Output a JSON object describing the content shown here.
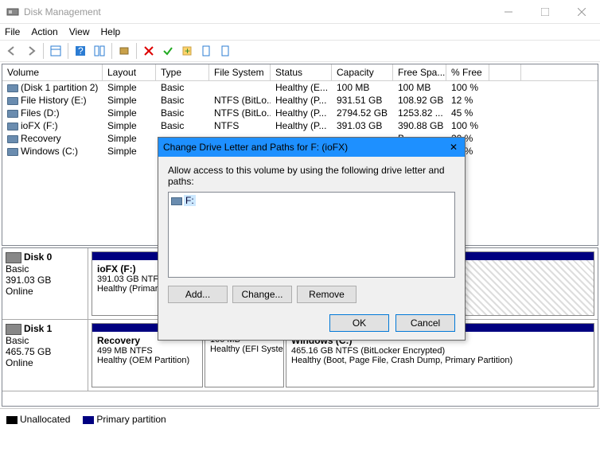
{
  "window": {
    "title": "Disk Management"
  },
  "menu": {
    "file": "File",
    "action": "Action",
    "view": "View",
    "help": "Help"
  },
  "columns": [
    "Volume",
    "Layout",
    "Type",
    "File System",
    "Status",
    "Capacity",
    "Free Spa...",
    "% Free"
  ],
  "volumes": [
    {
      "name": "(Disk 1 partition 2)",
      "layout": "Simple",
      "type": "Basic",
      "fs": "",
      "status": "Healthy (E...",
      "cap": "100 MB",
      "free": "100 MB",
      "pct": "100 %"
    },
    {
      "name": "File History (E:)",
      "layout": "Simple",
      "type": "Basic",
      "fs": "NTFS (BitLo...",
      "status": "Healthy (P...",
      "cap": "931.51 GB",
      "free": "108.92 GB",
      "pct": "12 %"
    },
    {
      "name": "Files (D:)",
      "layout": "Simple",
      "type": "Basic",
      "fs": "NTFS (BitLo...",
      "status": "Healthy (P...",
      "cap": "2794.52 GB",
      "free": "1253.82 ...",
      "pct": "45 %"
    },
    {
      "name": "ioFX (F:)",
      "layout": "Simple",
      "type": "Basic",
      "fs": "NTFS",
      "status": "Healthy (P...",
      "cap": "391.03 GB",
      "free": "390.88 GB",
      "pct": "100 %"
    },
    {
      "name": "Recovery",
      "layout": "Simple",
      "type": "",
      "fs": "",
      "status": "",
      "cap": "",
      "free": "B",
      "pct": "20 %"
    },
    {
      "name": "Windows (C:)",
      "layout": "Simple",
      "type": "",
      "fs": "",
      "status": "",
      "cap": "",
      "free": "7 GB",
      "pct": "12 %"
    }
  ],
  "disks": [
    {
      "name": "Disk 0",
      "type": "Basic",
      "size": "391.03 GB",
      "status": "Online",
      "parts": [
        {
          "name": "ioFX  (F:)",
          "l2": "391.03 GB NTFS",
          "l3": "Healthy (Primary Partition)",
          "flex": "0 0 96px",
          "hatch": false
        },
        {
          "name": "",
          "l2": "",
          "l3": "",
          "flex": "1",
          "hatch": true
        }
      ]
    },
    {
      "name": "Disk 1",
      "type": "Basic",
      "size": "465.75 GB",
      "status": "Online",
      "parts": [
        {
          "name": "Recovery",
          "l2": "499 MB NTFS",
          "l3": "Healthy (OEM Partition)",
          "flex": "0 0 140px",
          "hatch": false
        },
        {
          "name": "",
          "l2": "100 MB",
          "l3": "Healthy (EFI System Partition)",
          "flex": "0 0 100px",
          "hatch": false
        },
        {
          "name": "Windows  (C:)",
          "l2": "465.16 GB NTFS (BitLocker Encrypted)",
          "l3": "Healthy (Boot, Page File, Crash Dump, Primary Partition)",
          "flex": "1",
          "hatch": false
        }
      ]
    }
  ],
  "legend": {
    "unalloc": "Unallocated",
    "primary": "Primary partition"
  },
  "dialog": {
    "title": "Change Drive Letter and Paths for F: (ioFX)",
    "instr": "Allow access to this volume by using the following drive letter and paths:",
    "item": "F:",
    "add": "Add...",
    "change": "Change...",
    "remove": "Remove",
    "ok": "OK",
    "cancel": "Cancel"
  }
}
